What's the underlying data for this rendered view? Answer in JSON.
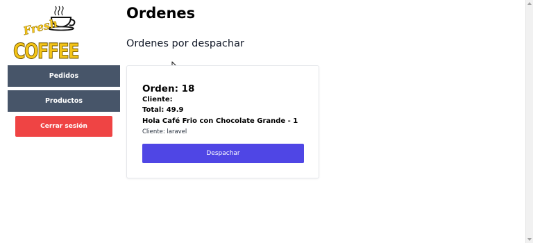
{
  "logo": {
    "word_fresh": "Fresh",
    "word_coffee": "COFFEE"
  },
  "sidebar": {
    "items": [
      {
        "label": "Pedidos"
      },
      {
        "label": "Productos"
      }
    ],
    "logout_label": "Cerrar sesión"
  },
  "header": {
    "title": "Ordenes",
    "subtitle": "Ordenes por despachar"
  },
  "orders": [
    {
      "title": "Orden: 18",
      "client_label": "Cliente:",
      "total": "Total: 49.9",
      "item": "Hola Café Frio con Chocolate Grande - 1",
      "client": "Cliente: laravel",
      "action_label": "Despachar"
    }
  ],
  "colors": {
    "nav_button": "#475569",
    "logout_button": "#ef4444",
    "dispatch_button": "#4f46e5",
    "logo_yellow": "#f5c518"
  },
  "icons": [
    "coffee-cup-icon",
    "mouse-cursor-icon"
  ]
}
